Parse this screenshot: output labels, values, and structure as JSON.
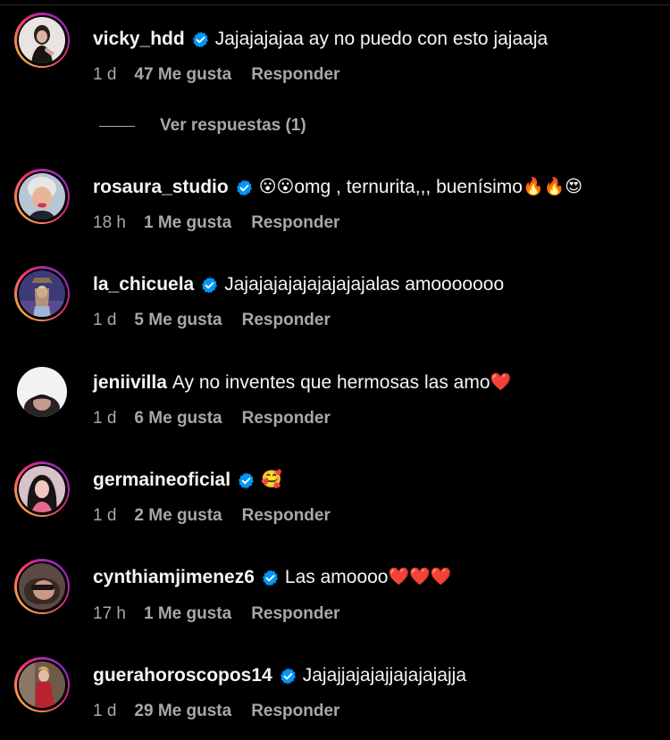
{
  "comments": [
    {
      "username": "vicky_hdd",
      "verified": true,
      "text": "Jajajajajaa ay no puedo con esto jajaaja",
      "emoji": "",
      "time": "1 d",
      "likes": "47 Me gusta",
      "reply": "Responder",
      "has_story": true
    },
    {
      "username": "rosaura_studio",
      "verified": true,
      "text_pre_emoji": "😮😮",
      "text": "omg , ternurita,,, buenísimo",
      "emoji": "🔥🔥😍",
      "time": "18 h",
      "likes": "1 Me gusta",
      "reply": "Responder",
      "has_story": true
    },
    {
      "username": "la_chicuela",
      "verified": true,
      "text": "Jajajajajajajajajajalas amooooooo",
      "emoji": "",
      "time": "1 d",
      "likes": "5 Me gusta",
      "reply": "Responder",
      "has_story": true
    },
    {
      "username": "jeniivilla",
      "verified": false,
      "text": "Ay no inventes que hermosas las amo",
      "emoji": "❤️",
      "time": "1 d",
      "likes": "6 Me gusta",
      "reply": "Responder",
      "has_story": false
    },
    {
      "username": "germaineoficial",
      "verified": true,
      "text": "",
      "emoji": "🥰",
      "time": "1 d",
      "likes": "2 Me gusta",
      "reply": "Responder",
      "has_story": true
    },
    {
      "username": "cynthiamjimenez6",
      "verified": true,
      "text": "Las amoooo ",
      "emoji": "❤️❤️❤️",
      "time": "17 h",
      "likes": "1 Me gusta",
      "reply": "Responder",
      "has_story": true
    },
    {
      "username": "guerahoroscopos14",
      "verified": true,
      "text": "Jajajjajajajjajajajajja",
      "emoji": "",
      "time": "1 d",
      "likes": "29 Me gusta",
      "reply": "Responder",
      "has_story": true
    }
  ],
  "view_replies": "Ver respuestas (1)",
  "colors": {
    "background": "#000000",
    "primary_text": "#f5f5f5",
    "secondary_text": "#a8a8a8",
    "verified_badge": "#0095f6"
  },
  "icons": {
    "verified": "verified-badge-icon"
  }
}
